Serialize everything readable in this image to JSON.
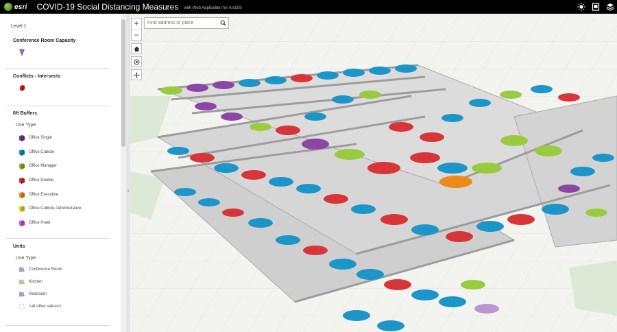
{
  "header": {
    "logo": "esri",
    "title": "COVID-19 Social Distancing Measures",
    "subtitle": "with Web AppBuilder for ArcGIS",
    "icons": [
      "daylight-icon",
      "layer-list-icon",
      "basemap-icon"
    ]
  },
  "search": {
    "placeholder": "Find address or place"
  },
  "map_controls": {
    "zoom_in": "+",
    "zoom_out": "−",
    "icons": [
      "home-icon",
      "locate-icon",
      "navigation-icon",
      "search-icon"
    ]
  },
  "legend": {
    "level": "Level 1",
    "conference_capacity": {
      "title": "Conference Room Capacity",
      "color": "#9b6bb5"
    },
    "conflicts": {
      "title": "Conflicts - Intersects",
      "color": "#d11f2a"
    },
    "buffers": {
      "title": "6ft Buffers",
      "use_type": "Use Type",
      "items": [
        {
          "label": "Office Single",
          "color": "#7b3a96"
        },
        {
          "label": "Office Cubicle",
          "color": "#1b8fc4"
        },
        {
          "label": "Office Manager",
          "color": "#8ab52d"
        },
        {
          "label": "Office Double",
          "color": "#d1323a"
        },
        {
          "label": "Office Executive",
          "color": "#ec8a1c"
        },
        {
          "label": "Office Cubicle Administrative",
          "color": "#e9d21f"
        },
        {
          "label": "Office Hotel",
          "color": "#d25ac6"
        }
      ]
    },
    "units": {
      "title": "Units",
      "use_type": "Use Type",
      "items": [
        {
          "label": "Conference Room",
          "color": "#b996cf"
        },
        {
          "label": "Kitchen",
          "color": "#a7cf8f"
        },
        {
          "label": "Restroom",
          "color": "#8ea6c8"
        },
        {
          "label": "<all other values>",
          "color": "#ffffff"
        }
      ]
    }
  }
}
